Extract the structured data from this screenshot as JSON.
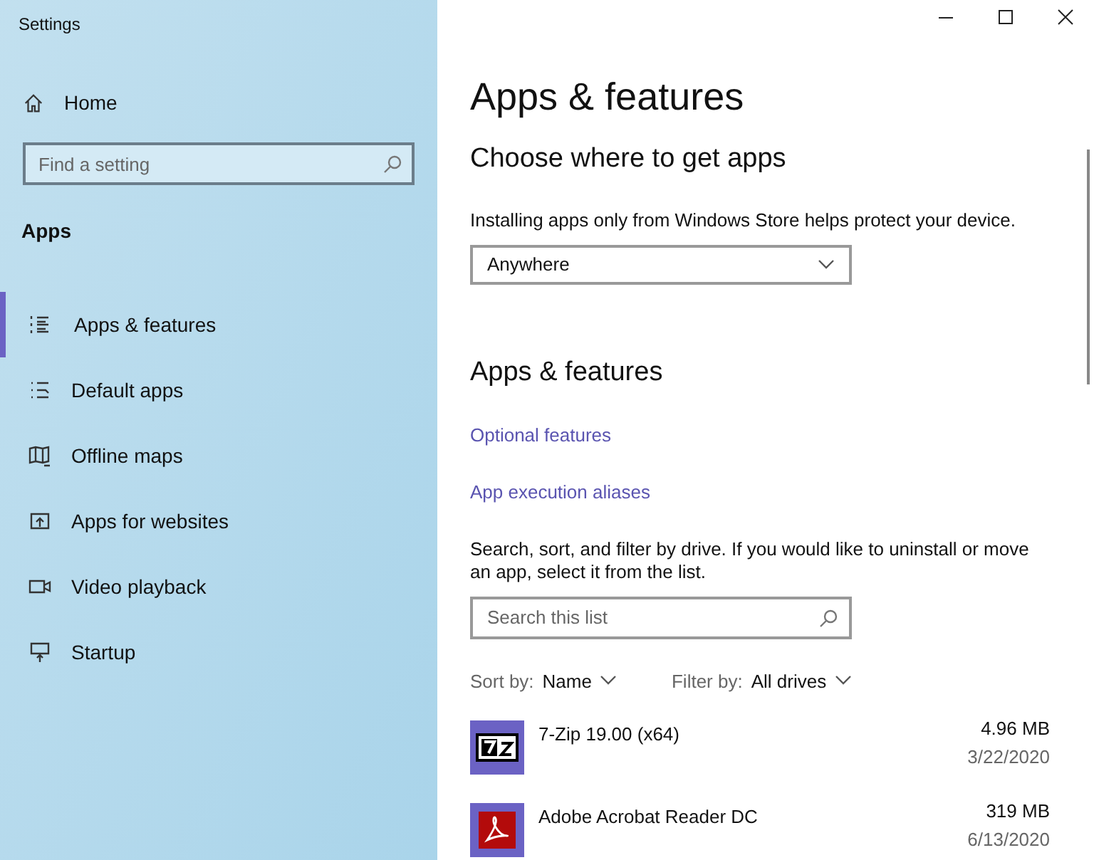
{
  "window": {
    "title": "Settings"
  },
  "sidebar": {
    "home": "Home",
    "search": {
      "placeholder": "Find a setting"
    },
    "section": "Apps",
    "items": [
      {
        "label": "Apps & features",
        "kind": "list",
        "selected": true
      },
      {
        "label": "Default apps",
        "kind": "defaults",
        "selected": false
      },
      {
        "label": "Offline maps",
        "kind": "map",
        "selected": false
      },
      {
        "label": "Apps for websites",
        "kind": "web",
        "selected": false
      },
      {
        "label": "Video playback",
        "kind": "video",
        "selected": false
      },
      {
        "label": "Startup",
        "kind": "startup",
        "selected": false
      }
    ]
  },
  "main": {
    "title": "Apps & features",
    "source_heading": "Choose where to get apps",
    "source_description": "Installing apps only from Windows Store helps protect your device.",
    "source_dropdown": "Anywhere",
    "section_heading": "Apps & features",
    "links": [
      "Optional features",
      "App execution aliases"
    ],
    "list_description": "Search, sort, and filter by drive. If you would like to uninstall or move an app, select it from the list.",
    "list_search": {
      "placeholder": "Search this list"
    },
    "sort_label": "Sort by:",
    "sort_value": "Name",
    "filter_label": "Filter by:",
    "filter_value": "All drives",
    "apps": [
      {
        "name": "7-Zip 19.00 (x64)",
        "size": "4.96 MB",
        "date": "3/22/2020",
        "kind": "sevenzip"
      },
      {
        "name": "Adobe Acrobat Reader DC",
        "size": "319 MB",
        "date": "6/13/2020",
        "kind": "acrobat"
      }
    ]
  }
}
